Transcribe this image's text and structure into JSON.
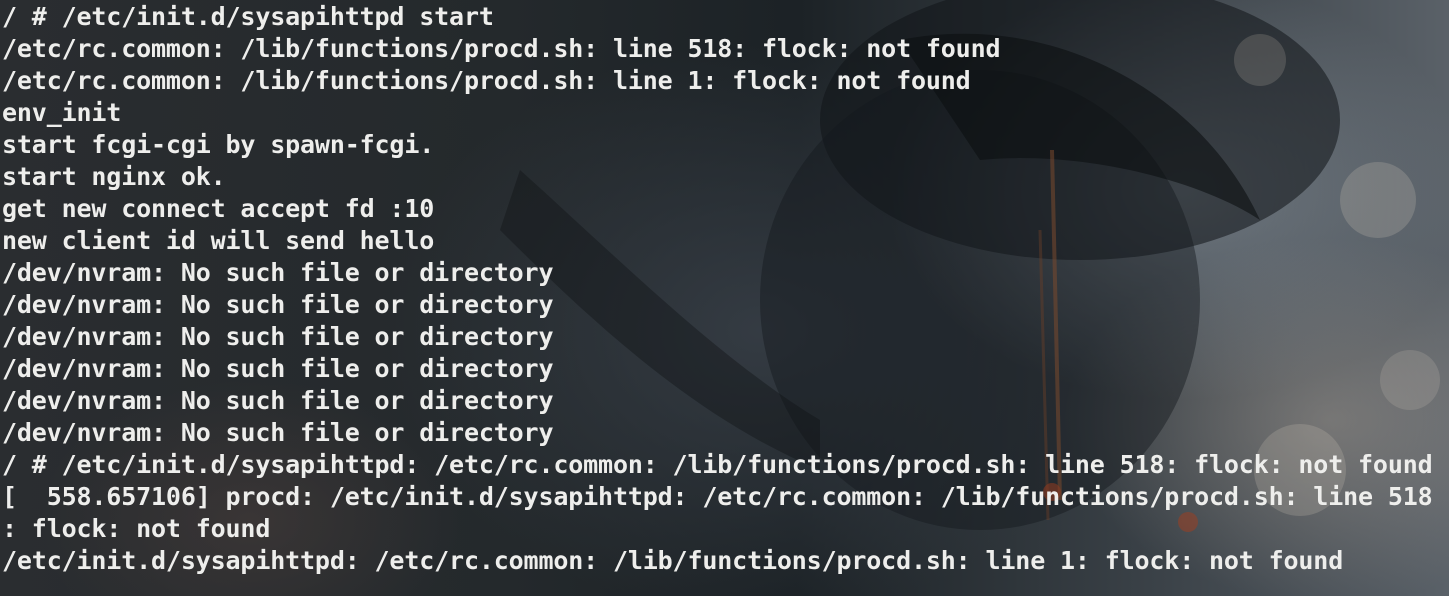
{
  "terminal": {
    "lines": [
      "/ # /etc/init.d/sysapihttpd start",
      "/etc/rc.common: /lib/functions/procd.sh: line 518: flock: not found",
      "/etc/rc.common: /lib/functions/procd.sh: line 1: flock: not found",
      "env_init",
      "start fcgi-cgi by spawn-fcgi.",
      "start nginx ok.",
      "get new connect accept fd :10",
      "new client id will send hello",
      "/dev/nvram: No such file or directory",
      "/dev/nvram: No such file or directory",
      "/dev/nvram: No such file or directory",
      "/dev/nvram: No such file or directory",
      "/dev/nvram: No such file or directory",
      "/dev/nvram: No such file or directory",
      "/ # /etc/init.d/sysapihttpd: /etc/rc.common: /lib/functions/procd.sh: line 518: flock: not found",
      "[  558.657106] procd: /etc/init.d/sysapihttpd: /etc/rc.common: /lib/functions/procd.sh: line 518",
      ": flock: not found",
      "/etc/init.d/sysapihttpd: /etc/rc.common: /lib/functions/procd.sh: line 1: flock: not found"
    ]
  },
  "colors": {
    "text": "#eeeeec",
    "background": "#1f2427"
  }
}
